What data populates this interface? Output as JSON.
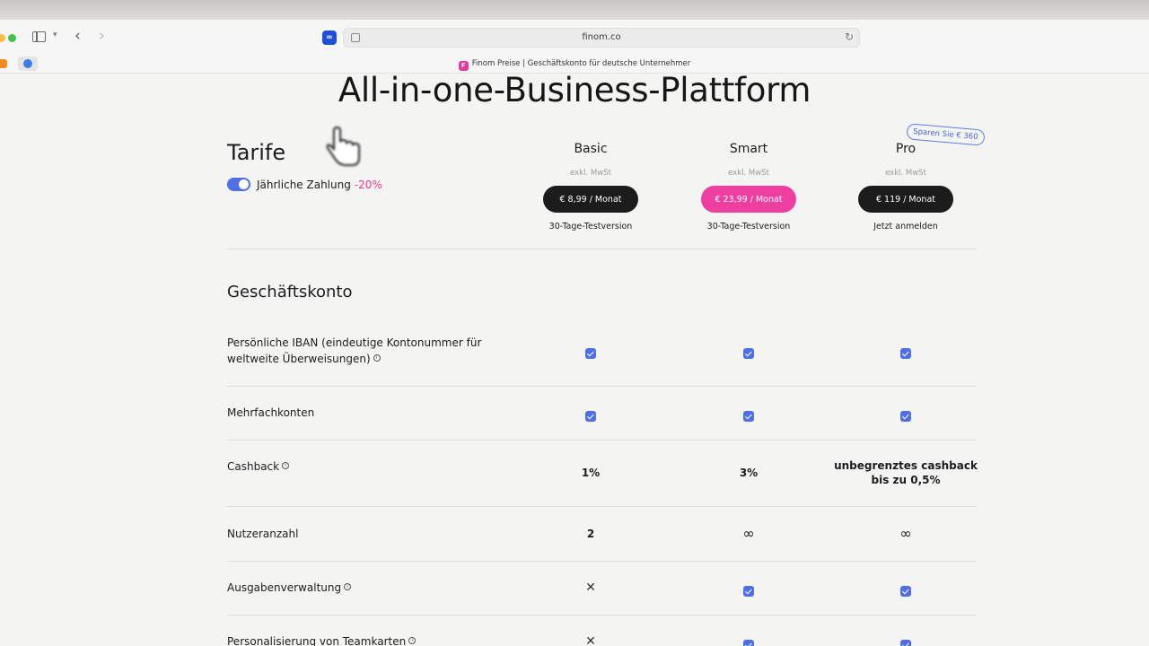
{
  "browser": {
    "url": "finom.co",
    "tab_title": "Finom Preise | Geschäftskonto für deutsche Unternehmer",
    "extension_icon": "infinity-extension-icon"
  },
  "colors": {
    "accent_blue": "#4f6fe6",
    "accent_pink": "#ee3fa0",
    "dark_button": "#1c1c1c"
  },
  "hero": {
    "title": "All-in-one-Business-Plattform"
  },
  "pricing": {
    "title": "Tarife",
    "toggle_label": "Jährliche Zahlung",
    "toggle_discount": "-20%",
    "save_badge": "Sparen Sie € 360",
    "plans": [
      {
        "name": "Basic",
        "tax_note": "exkl. MwSt",
        "price": "€ 8,99 / Monat",
        "cta": "30-Tage-Testversion"
      },
      {
        "name": "Smart",
        "tax_note": "exkl. MwSt",
        "price": "€ 23,99 / Monat",
        "cta": "30-Tage-Testversion"
      },
      {
        "name": "Pro",
        "tax_note": "exkl. MwSt",
        "price": "€ 119 / Monat",
        "cta": "Jetzt anmelden"
      }
    ]
  },
  "section": {
    "title": "Geschäftskonto",
    "rows": [
      {
        "label": "Persönliche IBAN (eindeutige Kontonummer für weltweite Überweisungen)",
        "values": [
          "check",
          "check",
          "check"
        ]
      },
      {
        "label": "Mehrfachkonten",
        "values": [
          "check",
          "check",
          "check"
        ]
      },
      {
        "label": "Cashback",
        "values": [
          "1%",
          "3%",
          "unbegrenztes cashback bis zu 0,5%"
        ]
      },
      {
        "label": "Nutzeranzahl",
        "values": [
          "2",
          "∞",
          "∞"
        ]
      },
      {
        "label": "Ausgabenverwaltung",
        "values": [
          "cross",
          "check",
          "check"
        ]
      },
      {
        "label": "Personalisierung von Teamkarten",
        "values": [
          "cross",
          "check",
          "check"
        ]
      }
    ],
    "cashback_pro_line1": "unbegrenztes cashback",
    "cashback_pro_line2": "bis zu 0,5%"
  }
}
